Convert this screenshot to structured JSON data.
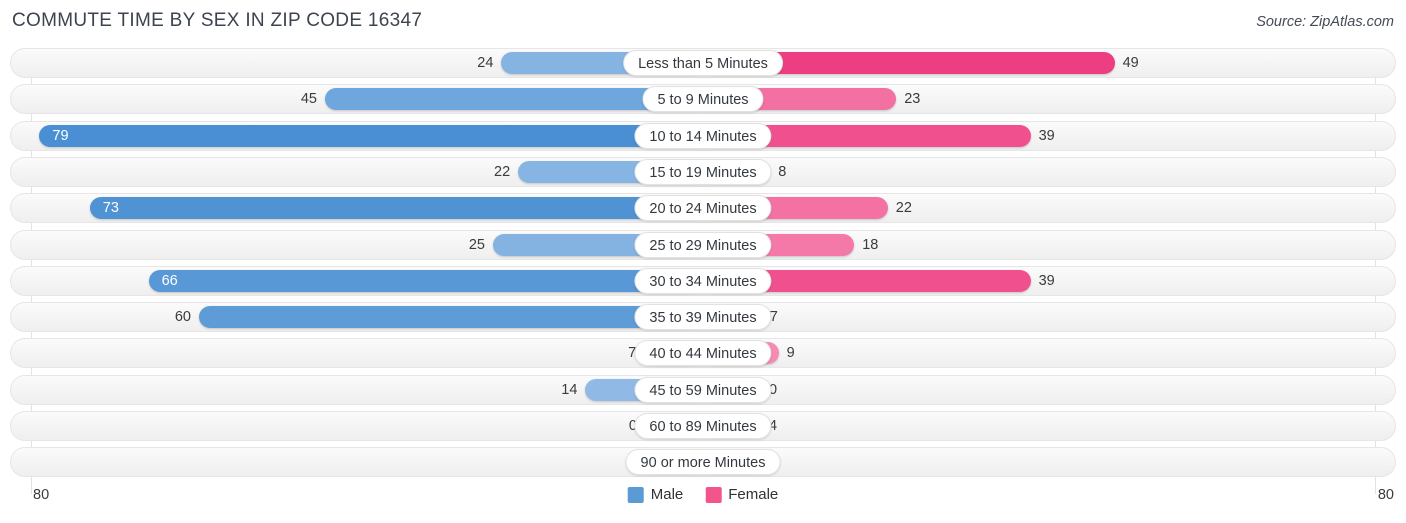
{
  "header": {
    "title": "COMMUTE TIME BY SEX IN ZIP CODE 16347",
    "source": "Source: ZipAtlas.com"
  },
  "axis": {
    "left_max_label": "80",
    "right_max_label": "80"
  },
  "legend": {
    "items": [
      {
        "label": "Male",
        "color": "#5b9bd5"
      },
      {
        "label": "Female",
        "color": "#f2558c"
      }
    ]
  },
  "colors": {
    "male": "#5b9bd5",
    "female": "#f2558c",
    "track": "#f4f4f4",
    "title": "#3d4450"
  },
  "chart_data": {
    "type": "bar",
    "title": "COMMUTE TIME BY SEX IN ZIP CODE 16347",
    "orientation": "horizontal-diverging",
    "xlabel": "",
    "ylabel": "",
    "xlim": [
      80,
      80
    ],
    "grid": false,
    "legend_position": "bottom-center",
    "categories": [
      "Less than 5 Minutes",
      "5 to 9 Minutes",
      "10 to 14 Minutes",
      "15 to 19 Minutes",
      "20 to 24 Minutes",
      "25 to 29 Minutes",
      "30 to 34 Minutes",
      "35 to 39 Minutes",
      "40 to 44 Minutes",
      "45 to 59 Minutes",
      "60 to 89 Minutes",
      "90 or more Minutes"
    ],
    "series": [
      {
        "name": "Male",
        "side": "left",
        "values": [
          24,
          45,
          79,
          22,
          73,
          25,
          66,
          60,
          7,
          14,
          0,
          0
        ]
      },
      {
        "name": "Female",
        "side": "right",
        "values": [
          49,
          23,
          39,
          8,
          22,
          18,
          39,
          7,
          9,
          0,
          4,
          0
        ]
      }
    ]
  }
}
